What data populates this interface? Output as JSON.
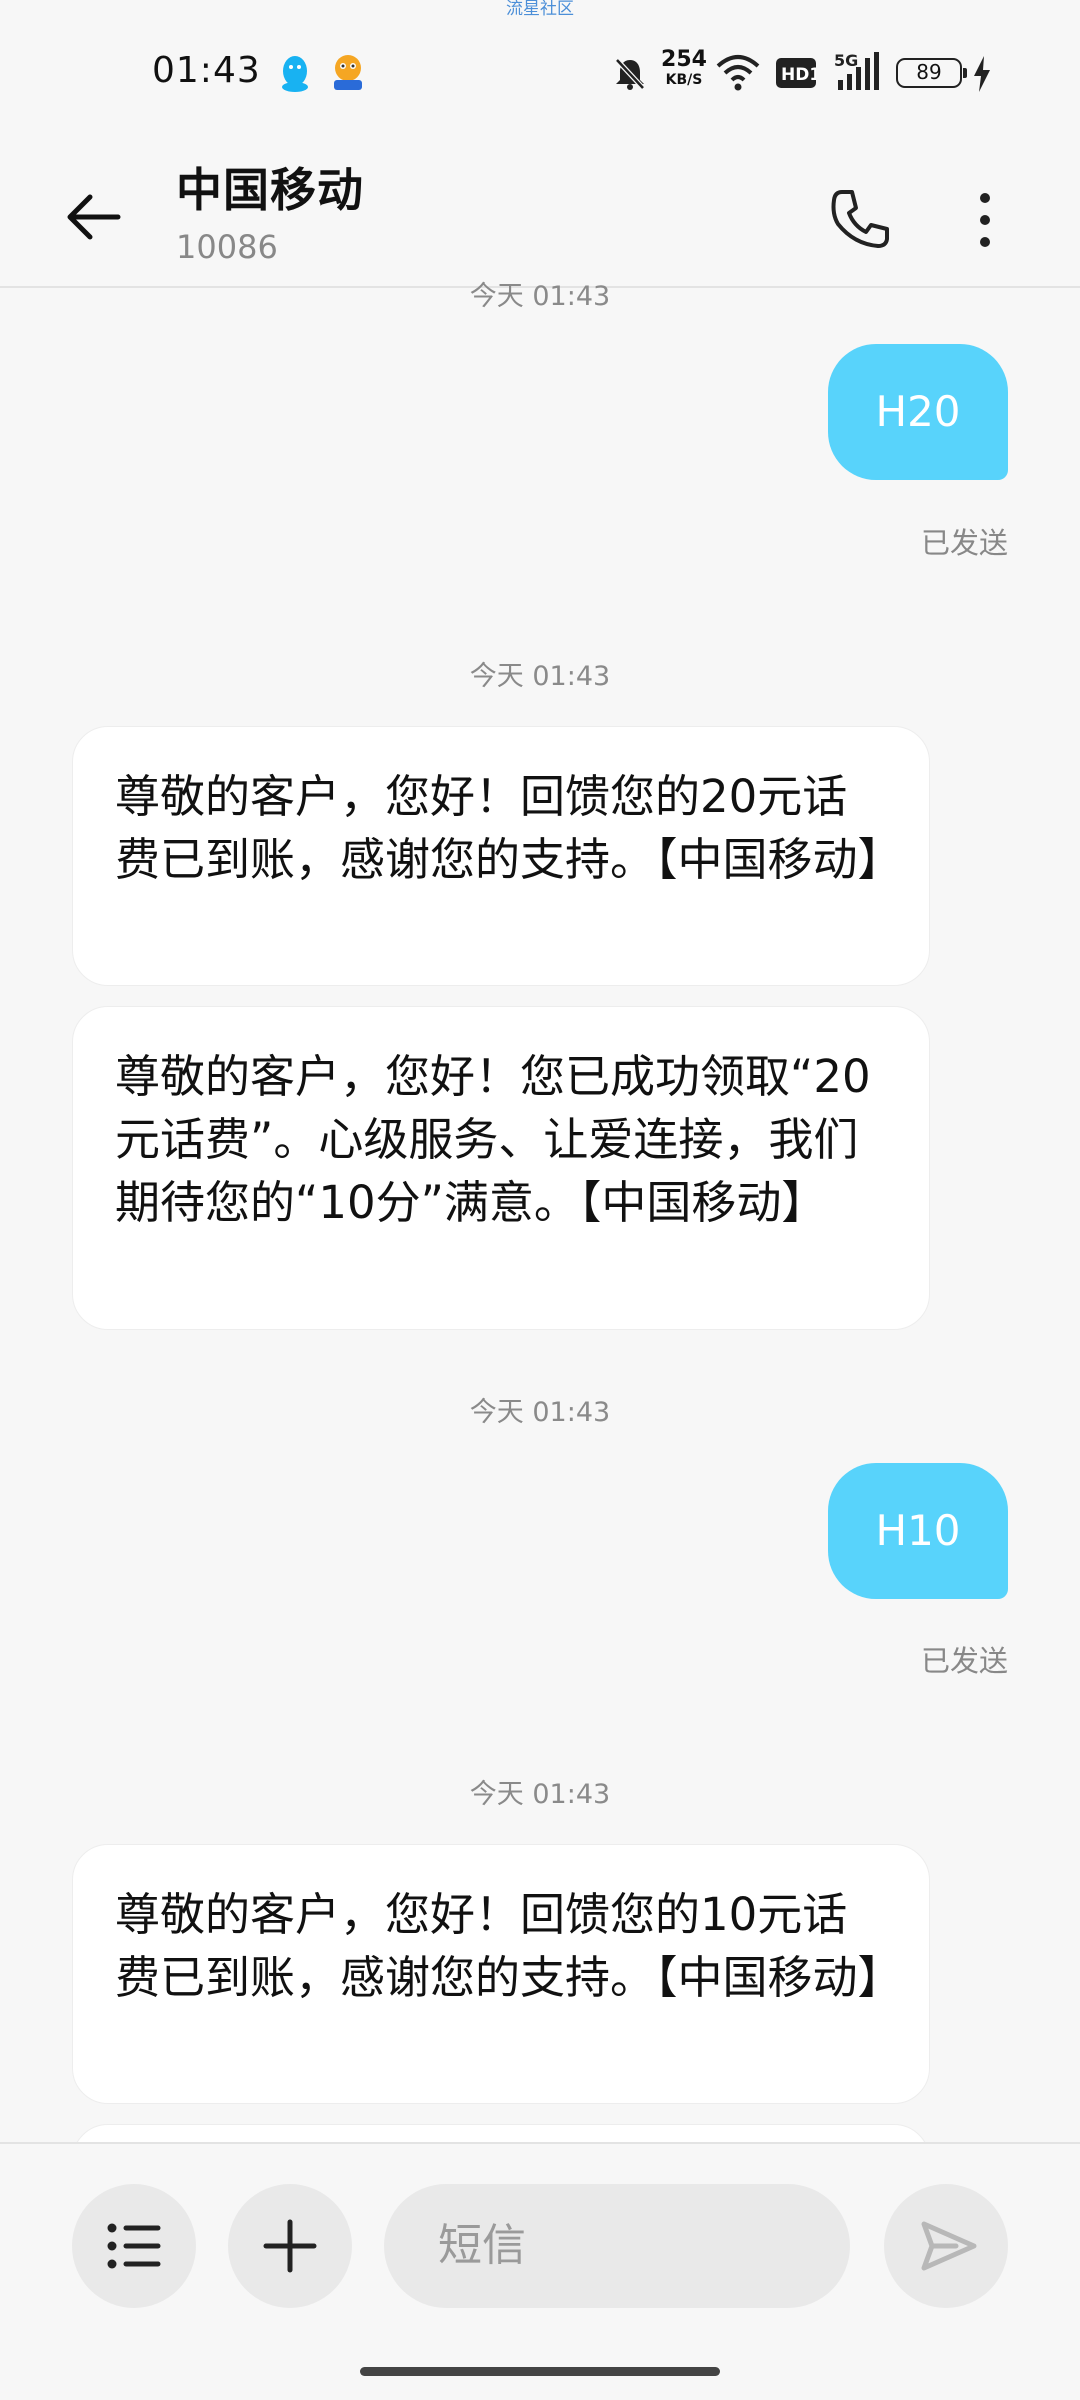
{
  "watermark": "流星社区",
  "status_bar": {
    "time": "01:43",
    "net_speed_value": "254",
    "net_speed_unit": "KB/S",
    "hd_label": "HD1",
    "network_label": "5G",
    "battery_level": "89",
    "icons": [
      "qq-icon",
      "app-mascot-icon",
      "bell-muted-icon",
      "wifi-icon",
      "hd-icon",
      "signal-icon",
      "battery-icon",
      "charging-icon"
    ]
  },
  "header": {
    "title": "中国移动",
    "number": "10086",
    "icons": [
      "back-arrow-icon",
      "phone-icon",
      "more-vertical-icon"
    ]
  },
  "messages": {
    "top_stamp": "今天 01:43",
    "sent1_text": "H20",
    "sent1_status": "已发送",
    "stamp2": "今天 01:43",
    "recv1": "尊敬的客户，您好！回馈您的20元话费已到账，感谢您的支持。【中国移动】",
    "recv2": "尊敬的客户，您好！您已成功领取“20元话费”。心级服务、让爱连接，我们期待您的“10分”满意。【中国移动】",
    "stamp3": "今天 01:43",
    "sent2_text": "H10",
    "sent2_status": "已发送",
    "stamp4": "今天 01:43",
    "recv3": "尊敬的客户，您好！回馈您的10元话费已到账，感谢您的支持。【中国移动】"
  },
  "composer": {
    "placeholder": "短信",
    "icons": [
      "list-icon",
      "plus-icon",
      "send-icon"
    ]
  },
  "colors": {
    "sent_bubble": "#58d3fb",
    "background": "#f7f7f7",
    "received_bubble": "#ffffff"
  }
}
